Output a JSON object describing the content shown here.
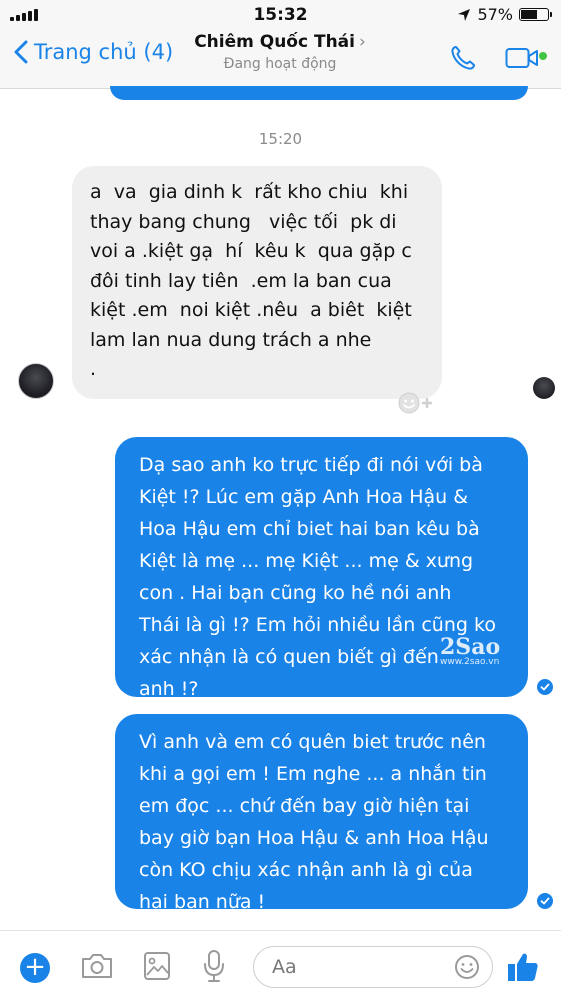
{
  "status_bar": {
    "time": "15:32",
    "battery": "57%",
    "battery_level": 0.57
  },
  "header": {
    "back_label": "Trang chủ (4)",
    "contact_name": "Chiêm Quốc Thái",
    "contact_status": "Đang hoạt động"
  },
  "conversation": {
    "timestamp": "15:20",
    "incoming": {
      "lines": [
        "a  va  gia dinh k  rất kho chiu  khi",
        "thay bang chung   việc tối  pk di",
        "voi a .kiệt gạ  hí  kêu k  qua gặp c",
        "đôi tinh lay tiên  .em la ban cua",
        "kiệt .em  noi kiệt .nêu  a biêt  kiệt",
        "lam lan nua dung trách a nhe",
        "."
      ]
    },
    "outgoing_1": {
      "lines": [
        "Dạ sao anh ko trực tiếp đi nói với bà",
        "Kiệt !? Lúc em gặp Anh Hoa Hậu &",
        "Hoa Hậu em chỉ biet hai ban kêu bà",
        "Kiệt là mẹ ... mẹ Kiệt ... mẹ & xưng",
        "con . Hai bạn cũng ko hề nói anh",
        "Thái là gì !? Em hỏi nhiều lần cũng ko",
        "xác nhận là có quen biết gì đến",
        "anh !?"
      ]
    },
    "outgoing_2": {
      "lines": [
        "Vì anh và em có quên biet trước nên",
        "khi a gọi em ! Em nghe ... a nhắn tin",
        "em đọc ... chứ đến bay giờ hiện tại",
        "bay giờ bạn Hoa Hậu & anh Hoa Hậu",
        "còn KO chịu xác nhận anh là gì của",
        "hai bạn nữa !"
      ]
    }
  },
  "watermark": {
    "logo": "2Sao",
    "url": "www.2sao.vn"
  },
  "composer": {
    "placeholder": "Aa"
  },
  "colors": {
    "accent": "#1a83e8",
    "incoming_bubble": "#efefef",
    "online": "#43c443"
  }
}
